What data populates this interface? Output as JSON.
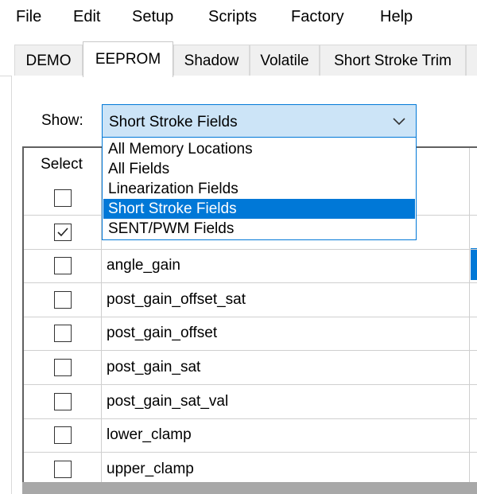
{
  "menu": [
    "File",
    "Edit",
    "Setup",
    "Scripts",
    "Factory",
    "Help"
  ],
  "tabs": [
    {
      "label": "DEMO",
      "active": false
    },
    {
      "label": "EEPROM",
      "active": true
    },
    {
      "label": "Shadow",
      "active": false
    },
    {
      "label": "Volatile",
      "active": false
    },
    {
      "label": "Short Stroke Trim",
      "active": false
    }
  ],
  "show": {
    "label": "Show:",
    "selected": "Short Stroke Fields",
    "options": [
      "All Memory Locations",
      "All Fields",
      "Linearization Fields",
      "Short Stroke Fields",
      "SENT/PWM Fields"
    ],
    "selected_index": 3
  },
  "grid": {
    "select_header": "Select",
    "rows": [
      {
        "name": "",
        "checked": false
      },
      {
        "name": "",
        "checked": true
      },
      {
        "name": "angle_gain",
        "checked": false
      },
      {
        "name": "post_gain_offset_sat",
        "checked": false
      },
      {
        "name": "post_gain_offset",
        "checked": false
      },
      {
        "name": "post_gain_sat",
        "checked": false
      },
      {
        "name": "post_gain_sat_val",
        "checked": false
      },
      {
        "name": "lower_clamp",
        "checked": false
      },
      {
        "name": "upper_clamp",
        "checked": false
      }
    ]
  },
  "colors": {
    "accent": "#0078d7",
    "combo_bg": "#cce4f7"
  }
}
